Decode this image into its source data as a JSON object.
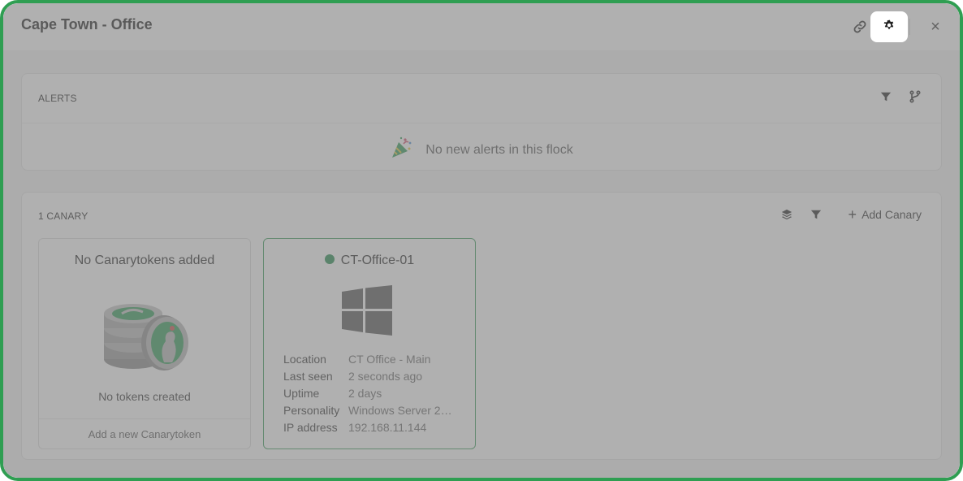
{
  "window": {
    "title": "Cape Town - Office"
  },
  "header": {
    "link_icon": "link-icon",
    "settings_icon": "gear-icon",
    "close_icon": "close-icon",
    "close_glyph": "×"
  },
  "alerts": {
    "title": "ALERTS",
    "filter_icon": "filter-icon",
    "branch_icon": "branch-icon",
    "empty_icon": "party-popper-icon",
    "empty_text": "No new alerts in this flock"
  },
  "canaries": {
    "title": "1 CANARY",
    "layers_icon": "layers-icon",
    "filter_icon": "filter-icon",
    "add_label": "Add Canary",
    "add_glyph": "+",
    "tokens_card": {
      "title": "No Canarytokens added",
      "image": "coin-stack-illustration",
      "subtitle": "No tokens created",
      "footer": "Add a new Canarytoken"
    },
    "device": {
      "name": "CT-Office-01",
      "status_color": "#1e8a4a",
      "os_icon": "windows-icon",
      "fields": [
        {
          "key": "Location",
          "value": "CT Office - Main"
        },
        {
          "key": "Last seen",
          "value": "2 seconds ago"
        },
        {
          "key": "Uptime",
          "value": "2 days"
        },
        {
          "key": "Personality",
          "value": "Windows Server 2…"
        },
        {
          "key": "IP address",
          "value": "192.168.11.144"
        }
      ]
    }
  },
  "colors": {
    "frame_border": "#2f9e52",
    "accent_green": "#1e8a4a",
    "overlay": "rgba(128,128,128,0.62)"
  }
}
